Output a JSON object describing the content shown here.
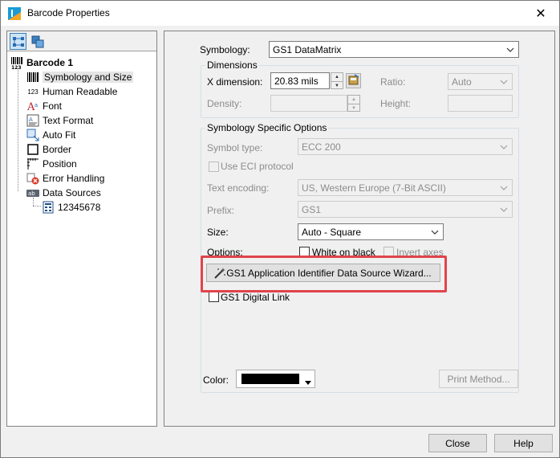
{
  "window": {
    "title": "Barcode Properties",
    "close_glyph": "✕"
  },
  "tree": {
    "root": "Barcode 1",
    "items": [
      {
        "label": "Symbology and Size",
        "icon": "barcode-icon"
      },
      {
        "label": "Human Readable",
        "icon": "numbers-icon",
        "icon_text": "123"
      },
      {
        "label": "Font",
        "icon": "font-icon"
      },
      {
        "label": "Text Format",
        "icon": "text-format-icon"
      },
      {
        "label": "Auto Fit",
        "icon": "auto-fit-icon"
      },
      {
        "label": "Border",
        "icon": "border-icon"
      },
      {
        "label": "Position",
        "icon": "position-icon"
      },
      {
        "label": "Error Handling",
        "icon": "error-icon"
      },
      {
        "label": "Data Sources",
        "icon": "data-sources-icon"
      }
    ],
    "data_source": "12345678"
  },
  "form": {
    "symbology_label": "Symbology:",
    "symbology_value": "GS1 DataMatrix",
    "dimensions_title": "Dimensions",
    "x_dimension_label": "X dimension:",
    "x_dimension_value": "20.83  mils",
    "ratio_label": "Ratio:",
    "ratio_value": "Auto",
    "density_label": "Density:",
    "height_label": "Height:",
    "specific_title": "Symbology Specific Options",
    "symbol_type_label": "Symbol type:",
    "symbol_type_value": "ECC 200",
    "eci_label": "Use ECI protocol",
    "text_encoding_label": "Text encoding:",
    "text_encoding_value": "US, Western Europe (7-Bit ASCII)",
    "prefix_label": "Prefix:",
    "prefix_value": "GS1",
    "size_label": "Size:",
    "size_value": "Auto - Square",
    "options_label": "Options:",
    "white_on_black_label": "White on black",
    "invert_axes_label": "Invert axes",
    "wizard_button": "GS1 Application Identifier Data Source Wizard...",
    "digital_link_label": "GS1 Digital Link",
    "color_label": "Color:",
    "color_value": "#000000",
    "print_method_button": "Print Method..."
  },
  "footer": {
    "close_button": "Close",
    "help_button": "Help"
  },
  "accent": {
    "highlight": "#e0444b",
    "selection": "#cce4f7"
  }
}
